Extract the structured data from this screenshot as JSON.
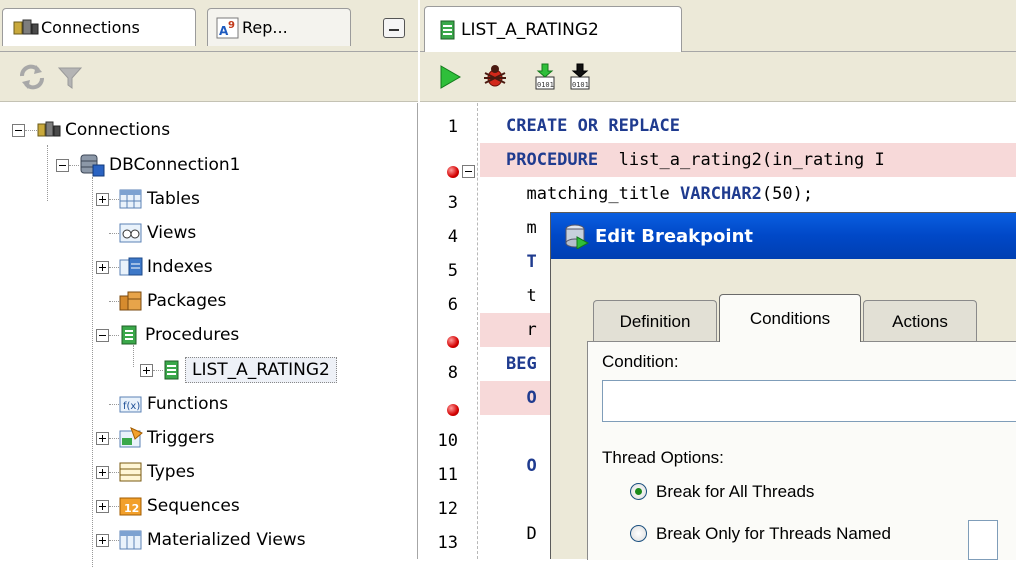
{
  "left_panel": {
    "tabs": [
      {
        "label": "Connections",
        "icon": "connections-icon",
        "active": true
      },
      {
        "label": "Rep...",
        "icon": "reports-icon",
        "active": false
      }
    ],
    "toolbar": {
      "icons": [
        "refresh-icon",
        "filter-icon"
      ]
    },
    "tree": {
      "root": "Connections",
      "connection": "DBConnection1",
      "nodes": [
        {
          "label": "Tables",
          "icon": "tables-icon",
          "expandable": true
        },
        {
          "label": "Views",
          "icon": "views-icon",
          "expandable": false
        },
        {
          "label": "Indexes",
          "icon": "indexes-icon",
          "expandable": true
        },
        {
          "label": "Packages",
          "icon": "packages-icon",
          "expandable": false
        },
        {
          "label": "Procedures",
          "icon": "procedures-icon",
          "expandable": true,
          "expanded": true
        },
        {
          "label": "Functions",
          "icon": "functions-icon",
          "expandable": false
        },
        {
          "label": "Triggers",
          "icon": "triggers-icon",
          "expandable": true
        },
        {
          "label": "Types",
          "icon": "types-icon",
          "expandable": true
        },
        {
          "label": "Sequences",
          "icon": "sequences-icon",
          "expandable": true
        },
        {
          "label": "Materialized Views",
          "icon": "materialized-views-icon",
          "expandable": true
        }
      ],
      "procedure_child": "LIST_A_RATING2"
    }
  },
  "editor": {
    "tab_label": "LIST_A_RATING2",
    "toolbar": {
      "icons": [
        "run-icon",
        "debug-icon",
        "compile-icon",
        "compile-debug-icon"
      ]
    },
    "lines": [
      {
        "num": "1",
        "parts": [
          {
            "t": "CREATE OR REPLACE",
            "k": true
          }
        ],
        "bp": false
      },
      {
        "num": "",
        "parts": [
          {
            "t": "PROCEDURE",
            "k": true
          },
          {
            "t": "  list_a_rating2(in_rating I",
            "k": false
          }
        ],
        "bp": true
      },
      {
        "num": "3",
        "parts": [
          {
            "t": "  matching_title ",
            "k": false
          },
          {
            "t": "VARCHAR2",
            "k": true
          },
          {
            "t": "(50);",
            "k": false
          }
        ],
        "bp": false
      },
      {
        "num": "4",
        "parts": [
          {
            "t": "  m",
            "k": false
          }
        ],
        "bp": false
      },
      {
        "num": "5",
        "parts": [
          {
            "t": "  T",
            "k": true
          }
        ],
        "bp": false
      },
      {
        "num": "6",
        "parts": [
          {
            "t": "  t",
            "k": false
          }
        ],
        "bp": false
      },
      {
        "num": "",
        "parts": [
          {
            "t": "  r",
            "k": false
          }
        ],
        "bp": true
      },
      {
        "num": "8",
        "parts": [
          {
            "t": "BEG",
            "k": true
          }
        ],
        "bp": false
      },
      {
        "num": "",
        "parts": [
          {
            "t": "  O",
            "k": true
          }
        ],
        "bp": true
      },
      {
        "num": "10",
        "parts": [
          {
            "t": "",
            "k": false
          }
        ],
        "bp": false
      },
      {
        "num": "11",
        "parts": [
          {
            "t": "  O",
            "k": true
          }
        ],
        "bp": false
      },
      {
        "num": "12",
        "parts": [
          {
            "t": "",
            "k": false
          }
        ],
        "bp": false
      },
      {
        "num": "13",
        "parts": [
          {
            "t": "  D",
            "k": false
          }
        ],
        "bp": false
      }
    ]
  },
  "dialog": {
    "title": "Edit Breakpoint",
    "tabs": [
      "Definition",
      "Conditions",
      "Actions"
    ],
    "active_tab": "Conditions",
    "condition_label": "Condition:",
    "condition_value": "",
    "thread_options_label": "Thread Options:",
    "radio_options": [
      {
        "label": "Break for All Threads",
        "checked": true
      },
      {
        "label": "Break Only for Threads Named",
        "checked": false
      }
    ]
  },
  "colors": {
    "breakpoint_line": "#f7d9d9",
    "keyword": "#1f3b8f",
    "titlebar": "#0048c7",
    "chrome": "#ece9d8"
  }
}
